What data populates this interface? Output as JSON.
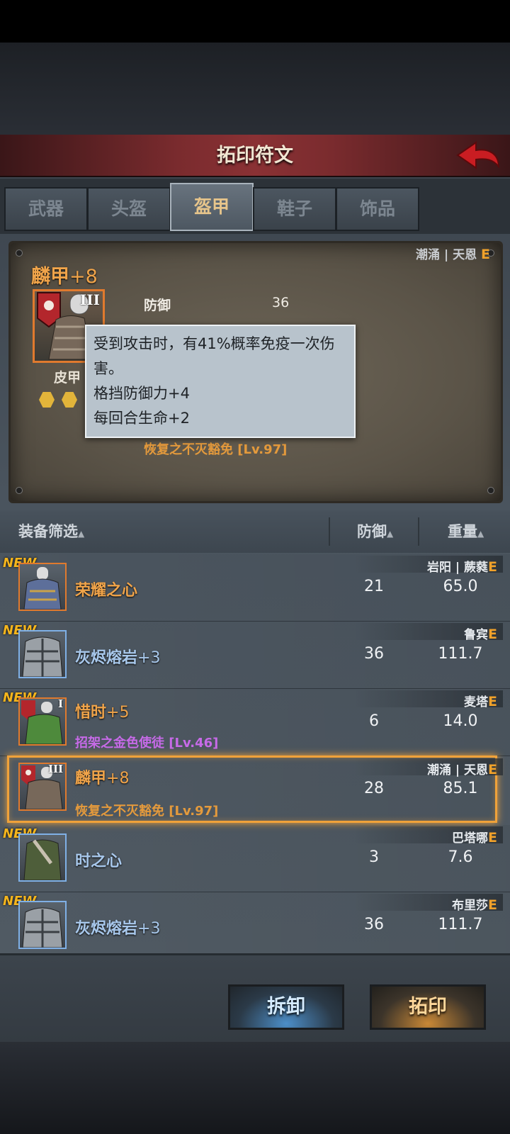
{
  "header": {
    "title": "拓印符文"
  },
  "tabs": [
    {
      "label": "武器"
    },
    {
      "label": "头盔"
    },
    {
      "label": "盔甲",
      "active": true
    },
    {
      "label": "鞋子"
    },
    {
      "label": "饰品"
    }
  ],
  "detail": {
    "set_name": "潮涌 | 天恩",
    "set_grade": "E",
    "name": "麟甲",
    "enhance": "+8",
    "tier": "III",
    "type": "皮甲",
    "stat_label": "防御",
    "stat_value": "36",
    "rune": "恢复之不灭豁免 [Lv.97]"
  },
  "tooltip": {
    "line1": "受到攻击时，有41%概率免疫一次伤害。",
    "line2": "格挡防御力+4",
    "line3": "每回合生命+2"
  },
  "filter": {
    "label": "装备筛选",
    "col_def": "防御",
    "col_weight": "重量",
    "arrow": "▲"
  },
  "rows": [
    {
      "new": "NEW",
      "set": "岩阳 | 蕨蕤",
      "grade": "E",
      "name": "荣耀之心",
      "plus": "",
      "def": "21",
      "weight": "65.0",
      "rune": ""
    },
    {
      "new": "NEW",
      "set": "鲁宾",
      "grade": "E",
      "name": "灰烬熔岩",
      "plus": "+3",
      "def": "36",
      "weight": "111.7",
      "rune": ""
    },
    {
      "new": "NEW",
      "set": "麦塔",
      "grade": "E",
      "name": "惜时",
      "plus": "+5",
      "def": "6",
      "weight": "14.0",
      "rune": "招架之金色使徒 [Lv.46]",
      "tier": "I"
    },
    {
      "new": "",
      "set": "潮涌 | 天恩",
      "grade": "E",
      "name": "麟甲",
      "plus": "+8",
      "def": "28",
      "weight": "85.1",
      "rune": "恢复之不灭豁免 [Lv.97]",
      "tier": "III"
    },
    {
      "new": "NEW",
      "set": "巴塔哪",
      "grade": "E",
      "name": "时之心",
      "plus": "",
      "def": "3",
      "weight": "7.6",
      "rune": ""
    },
    {
      "new": "NEW",
      "set": "布里莎",
      "grade": "E",
      "name": "灰烬熔岩",
      "plus": "+3",
      "def": "36",
      "weight": "111.7",
      "rune": ""
    }
  ],
  "buttons": {
    "dismantle": "拆卸",
    "imprint": "拓印"
  }
}
